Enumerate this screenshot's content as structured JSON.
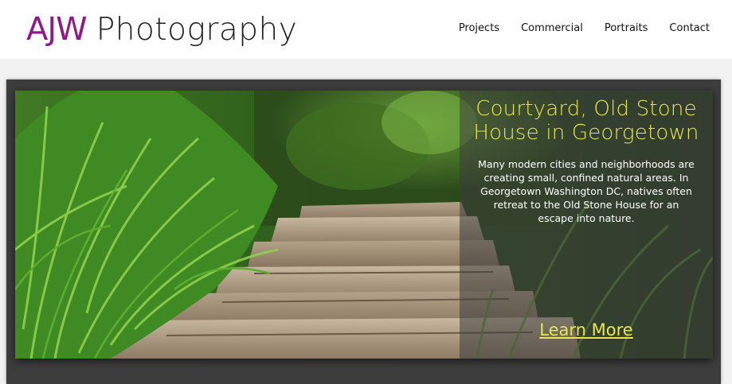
{
  "brand": {
    "mark": "AJW",
    "word": "Photography",
    "mark_color": "#8e1a8a"
  },
  "nav": {
    "items": [
      "Projects",
      "Commercial",
      "Portraits",
      "Contact"
    ]
  },
  "hero": {
    "title": "Courtyard, Old Stone House in Georgetown",
    "description": "Many modern cities and neighborhoods are creating small, confined natural areas. In Georgetown Washington DC, natives often retreat to the Old Stone House for an escape into nature.",
    "cta": "Learn More",
    "accent_color": "#e6e84a"
  }
}
